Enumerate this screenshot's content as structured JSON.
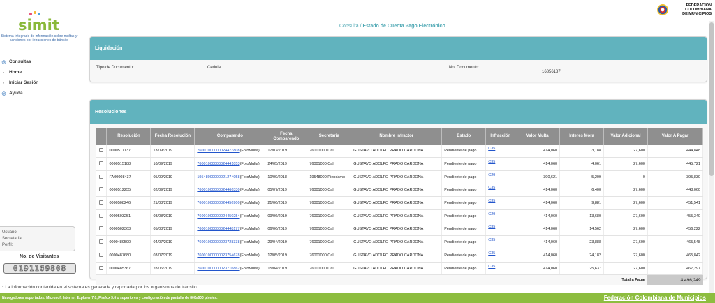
{
  "logo": {
    "text": "simit"
  },
  "tagline": "Sistema Integrado de información sobre multas y sanciones por infracciones de tránsito",
  "menu": [
    {
      "label": "Consultas",
      "icon": "circle-icon"
    },
    {
      "label": "Home",
      "icon": "bullet-icon"
    },
    {
      "label": "Iniciar Sesión",
      "icon": "bullet-icon"
    },
    {
      "label": "Ayuda",
      "icon": "circle-icon"
    }
  ],
  "user": {
    "usuario": "Usuario:",
    "secretaria": "Secretaría:",
    "perfil": "Perfil:"
  },
  "visitors": {
    "title": "No. de Visitantes",
    "count": "0191169808"
  },
  "header": {
    "breadcrumb_prefix": "Consulta /",
    "breadcrumb_page": "Estado de Cuenta Pago Electrónico",
    "org_logo_text": [
      "FEDERACIÓN",
      "COLOMBIANA",
      "DE MUNICIPIOS"
    ]
  },
  "liquidacion": {
    "title": "Liquidación",
    "tipo_label": "Tipo de Documento:",
    "tipo_value": "Cedula",
    "doc_label": "No. Documento:",
    "doc_value": "16856187"
  },
  "resoluciones": {
    "title": "Resoluciones",
    "columns": [
      "",
      "Resolución",
      "Fecha Resolución",
      "Comparendo",
      "Fecha Comparendo",
      "Secretaria",
      "Nombre Infractor",
      "Estado",
      "Infracción",
      "Valor Multa",
      "Interes Mora",
      "Valor Adicional",
      "Valor A Pagar"
    ],
    "rows": [
      {
        "resolucion": "0000517137",
        "fecha_res": "13/09/2019",
        "comparendo": "76001000000024473808",
        "comp_suffix": "(FotoMulta)",
        "fecha_comp": "17/07/2019",
        "secretaria": "76001000 Cali",
        "nombre": "GUSTAVO ADOLFO PRADO CARDONA",
        "estado": "Pendiente de pago",
        "infraccion": "C35",
        "multa": "414,060",
        "mora": "3,188",
        "adicional": "27,600",
        "pagar": "444,848"
      },
      {
        "resolucion": "0000515188",
        "fecha_res": "10/09/2019",
        "comparendo": "76001000000024441053",
        "comp_suffix": "(FotoMulta)",
        "fecha_comp": "24/05/2019",
        "secretaria": "76001000 Cali",
        "nombre": "GUSTAVO ADOLFO PRADO CARDONA",
        "estado": "Pendiente de pago",
        "infraccion": "C35",
        "multa": "414,060",
        "mora": "4,061",
        "adicional": "27,600",
        "pagar": "445,721"
      },
      {
        "resolucion": "FA00008437",
        "fecha_res": "05/09/2019",
        "comparendo": "19548000000021274058",
        "comp_suffix": "(FotoMulta)",
        "fecha_comp": "10/09/2018",
        "secretaria": "19548000 Piendamo",
        "nombre": "GUSTAVO ADOLFO PRADO CARDONA",
        "estado": "Pendiente de pago",
        "infraccion": "C29",
        "multa": "390,621",
        "mora": "5,209",
        "adicional": "0",
        "pagar": "395,830"
      },
      {
        "resolucion": "0000512255",
        "fecha_res": "02/09/2019",
        "comparendo": "76001000000024466330",
        "comp_suffix": "(FotoMulta)",
        "fecha_comp": "05/07/2019",
        "secretaria": "76001000 Cali",
        "nombre": "GUSTAVO ADOLFO PRADO CARDONA",
        "estado": "Pendiente de pago",
        "infraccion": "C35",
        "multa": "414,060",
        "mora": "6,400",
        "adicional": "27,600",
        "pagar": "448,060"
      },
      {
        "resolucion": "0000508246",
        "fecha_res": "21/08/2019",
        "comparendo": "76001000000024456900",
        "comp_suffix": "(FotoMulta)",
        "fecha_comp": "21/06/2019",
        "secretaria": "76001000 Cali",
        "nombre": "GUSTAVO ADOLFO PRADO CARDONA",
        "estado": "Pendiente de pago",
        "infraccion": "C35",
        "multa": "414,060",
        "mora": "9,881",
        "adicional": "27,600",
        "pagar": "451,541"
      },
      {
        "resolucion": "0000503251",
        "fecha_res": "08/08/2019",
        "comparendo": "76001000000024450254",
        "comp_suffix": "(FotoMulta)",
        "fecha_comp": "09/06/2019",
        "secretaria": "76001000 Cali",
        "nombre": "GUSTAVO ADOLFO PRADO CARDONA",
        "estado": "Pendiente de pago",
        "infraccion": "C29",
        "multa": "414,060",
        "mora": "13,680",
        "adicional": "27,600",
        "pagar": "455,340"
      },
      {
        "resolucion": "0000502363",
        "fecha_res": "05/08/2019",
        "comparendo": "76001000000024448177",
        "comp_suffix": "(FotoMulta)",
        "fecha_comp": "06/06/2019",
        "secretaria": "76001000 Cali",
        "nombre": "GUSTAVO ADOLFO PRADO CARDONA",
        "estado": "Pendiente de pago",
        "infraccion": "C35",
        "multa": "414,060",
        "mora": "14,562",
        "adicional": "27,600",
        "pagar": "456,222"
      },
      {
        "resolucion": "0000489590",
        "fecha_res": "04/07/2019",
        "comparendo": "76001000000023728338",
        "comp_suffix": "(FotoMulta)",
        "fecha_comp": "29/04/2019",
        "secretaria": "76001000 Cali",
        "nombre": "GUSTAVO ADOLFO PRADO CARDONA",
        "estado": "Pendiente de pago",
        "infraccion": "C35",
        "multa": "414,060",
        "mora": "23,888",
        "adicional": "27,600",
        "pagar": "465,548"
      },
      {
        "resolucion": "0000487680",
        "fecha_res": "03/07/2019",
        "comparendo": "76001000000023754678",
        "comp_suffix": "(FotoMulta)",
        "fecha_comp": "12/05/2019",
        "secretaria": "76001000 Cali",
        "nombre": "GUSTAVO ADOLFO PRADO CARDONA",
        "estado": "Pendiente de pago",
        "infraccion": "C35",
        "multa": "414,060",
        "mora": "24,182",
        "adicional": "27,600",
        "pagar": "465,842"
      },
      {
        "resolucion": "0000485367",
        "fecha_res": "28/06/2019",
        "comparendo": "76001000000023716862",
        "comp_suffix": "(FotoMulta)",
        "fecha_comp": "15/04/2019",
        "secretaria": "76001000 Cali",
        "nombre": "GUSTAVO ADOLFO PRADO CARDONA",
        "estado": "Pendiente de pago",
        "infraccion": "C35",
        "multa": "414,060",
        "mora": "25,637",
        "adicional": "27,600",
        "pagar": "467,297"
      }
    ],
    "total_label": "Total a Pagar",
    "total_value": "4,496,249"
  },
  "note": "* La información contenida en el sistema es generada y reportada por los organismos de tránsito.",
  "footer": {
    "prefix": "Navegadores soportados:",
    "ie": "Microsoft Internet Explorer 7.0",
    "sep": ",",
    "ff": "Firefox 3.6",
    "suffix": "o superiores y configuración de pantalla de 800x600 píxeles.",
    "org_link": "Federación Colombiana de Municipios"
  },
  "colors": {
    "accent": "#61b3be",
    "footer": "#8dbd3f",
    "brand": "#8ab93a",
    "link": "#2255cc"
  }
}
